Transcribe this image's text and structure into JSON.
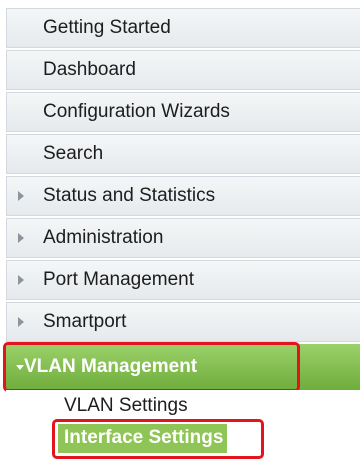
{
  "nav": {
    "items": [
      {
        "label": "Getting Started",
        "expandable": false
      },
      {
        "label": "Dashboard",
        "expandable": false
      },
      {
        "label": "Configuration Wizards",
        "expandable": false
      },
      {
        "label": "Search",
        "expandable": false
      },
      {
        "label": "Status and Statistics",
        "expandable": true
      },
      {
        "label": "Administration",
        "expandable": true
      },
      {
        "label": "Port Management",
        "expandable": true
      },
      {
        "label": "Smartport",
        "expandable": true
      }
    ],
    "active": {
      "label": "VLAN Management",
      "sub_items": [
        {
          "label": "VLAN Settings"
        },
        {
          "label": "Interface Settings"
        }
      ]
    }
  },
  "colors": {
    "active_green": "#7dbb47",
    "highlight_red": "#e3141d",
    "selected_green": "#8fc456"
  }
}
